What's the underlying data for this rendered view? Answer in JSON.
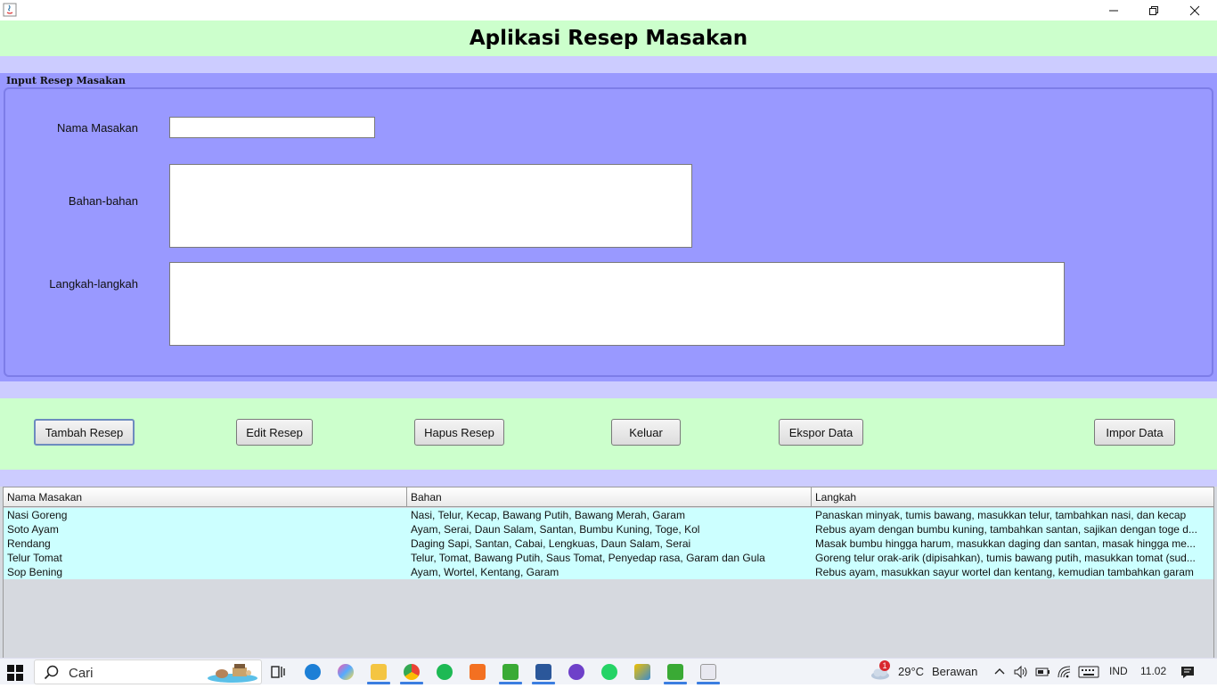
{
  "window": {
    "title": "",
    "minimize_glyph": "—",
    "restore_glyph": "❐",
    "close_glyph": "✕"
  },
  "header": {
    "title": "Aplikasi Resep Masakan"
  },
  "input_panel": {
    "group_title": "Input Resep Masakan",
    "fields": {
      "nama_label": "Nama Masakan",
      "nama_value": "",
      "bahan_label": "Bahan-bahan",
      "bahan_value": "",
      "langkah_label": "Langkah-langkah",
      "langkah_value": ""
    }
  },
  "buttons": {
    "tambah": "Tambah Resep",
    "edit": "Edit Resep",
    "hapus": "Hapus Resep",
    "keluar": "Keluar",
    "ekspor": "Ekspor Data",
    "impor": "Impor Data"
  },
  "table": {
    "columns": [
      "Nama Masakan",
      "Bahan",
      "Langkah"
    ],
    "rows": [
      [
        "Nasi Goreng",
        "Nasi, Telur, Kecap, Bawang Putih, Bawang Merah, Garam",
        "Panaskan minyak, tumis bawang, masukkan telur, tambahkan nasi, dan kecap"
      ],
      [
        "Soto Ayam",
        "Ayam, Serai, Daun Salam, Santan, Bumbu Kuning, Toge, Kol",
        "Rebus ayam dengan bumbu kuning, tambahkan santan, sajikan dengan toge d..."
      ],
      [
        "Rendang",
        "Daging Sapi, Santan, Cabai, Lengkuas, Daun Salam, Serai",
        "Masak bumbu hingga harum, masukkan daging dan santan, masak hingga me..."
      ],
      [
        "Telur Tomat",
        "Telur, Tomat, Bawang Putih, Saus Tomat, Penyedap rasa, Garam dan Gula",
        "Goreng telur orak-arik (dipisahkan), tumis bawang putih, masukkan tomat (sud..."
      ],
      [
        "Sop Bening",
        "Ayam, Wortel, Kentang, Garam",
        "Rebus ayam, masukkan sayur wortel dan kentang, kemudian tambahkan garam"
      ]
    ]
  },
  "taskbar": {
    "search_placeholder": "Cari",
    "weather_badge": "1",
    "weather_temp": "29°C",
    "weather_text": "Berawan",
    "language": "IND",
    "time": "11.02"
  },
  "colors": {
    "header_bg": "#ccffcc",
    "band_bg": "#ccccff",
    "panel_bg": "#9999ff",
    "row_bg": "#ccffff"
  }
}
